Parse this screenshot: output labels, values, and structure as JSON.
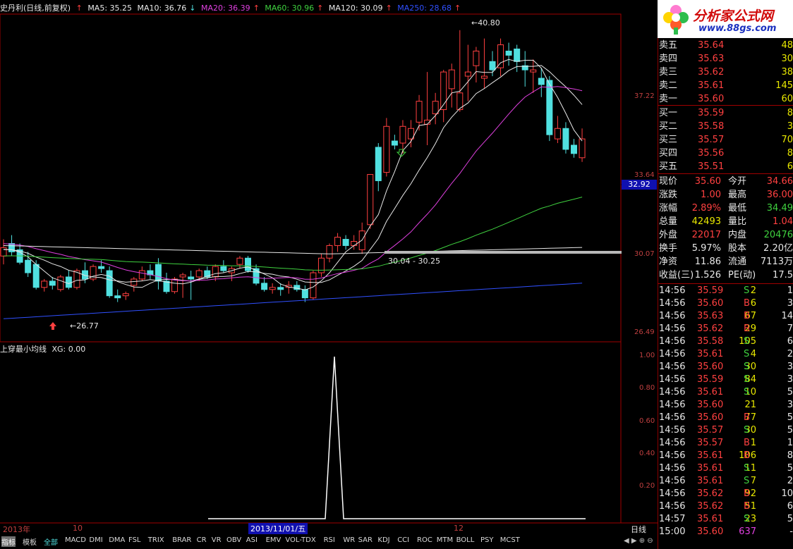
{
  "header": {
    "title": "史丹利(日线,前复权)",
    "ma": [
      {
        "label": "MA5: 35.25",
        "color": "#e8e8e8"
      },
      {
        "label": "MA10: 36.76",
        "color": "#e8e8e8"
      },
      {
        "label": "MA20: 36.39",
        "color": "#e040e0"
      },
      {
        "label": "MA60: 30.96",
        "color": "#3fd23f"
      },
      {
        "label": "MA120: 30.09",
        "color": "#e8e8e8"
      },
      {
        "label": "MA250: 28.68",
        "color": "#3050ff"
      }
    ]
  },
  "price_axis": {
    "labels": [
      "37.22",
      "33.64",
      "30.07",
      "26.49"
    ],
    "current_price_tag": "32.92"
  },
  "annotations": {
    "high": "40.80",
    "low": "26.77",
    "range": "30.04 - 30.25"
  },
  "indicator": {
    "title": "上穿最小均线",
    "value_label": "XG: 0.00",
    "axis_labels": [
      "1.00",
      "0.80",
      "0.60",
      "0.40",
      "0.20"
    ]
  },
  "date_axis": {
    "labels": [
      "2013年",
      "10",
      "2013/11/01/五",
      "12"
    ],
    "period": "日线"
  },
  "bottom_tabs": [
    "指标",
    "模板",
    "全部",
    "MACD",
    "DMI",
    "DMA",
    "FSL",
    "TRIX",
    "BRAR",
    "CR",
    "VR",
    "OBV",
    "ASI",
    "EMV",
    "VOL-TDX",
    "RSI",
    "WR",
    "SAR",
    "KDJ",
    "CCI",
    "ROC",
    "MTM",
    "BOLL",
    "PSY",
    "MCST"
  ],
  "logo": {
    "title": "分析家公式网",
    "url": "www.88gs.com"
  },
  "order_book": {
    "asks": [
      {
        "label": "卖五",
        "price": "35.64",
        "vol": "48"
      },
      {
        "label": "卖四",
        "price": "35.63",
        "vol": "30"
      },
      {
        "label": "卖三",
        "price": "35.62",
        "vol": "38"
      },
      {
        "label": "卖二",
        "price": "35.61",
        "vol": "145"
      },
      {
        "label": "卖一",
        "price": "35.60",
        "vol": "60"
      }
    ],
    "bids": [
      {
        "label": "买一",
        "price": "35.59",
        "vol": "8"
      },
      {
        "label": "买二",
        "price": "35.58",
        "vol": "3"
      },
      {
        "label": "买三",
        "price": "35.57",
        "vol": "70"
      },
      {
        "label": "买四",
        "price": "35.56",
        "vol": "8"
      },
      {
        "label": "买五",
        "price": "35.51",
        "vol": "6"
      }
    ]
  },
  "quote": [
    {
      "l1": "现价",
      "v1": "35.60",
      "c1": "red",
      "l2": "今开",
      "v2": "34.66",
      "c2": "red"
    },
    {
      "l1": "涨跌",
      "v1": "1.00",
      "c1": "red",
      "l2": "最高",
      "v2": "36.00",
      "c2": "red"
    },
    {
      "l1": "涨幅",
      "v1": "2.89%",
      "c1": "red",
      "l2": "最低",
      "v2": "34.49",
      "c2": "green"
    },
    {
      "l1": "总量",
      "v1": "42493",
      "c1": "yellow",
      "l2": "量比",
      "v2": "1.04",
      "c2": "red"
    },
    {
      "l1": "外盘",
      "v1": "22017",
      "c1": "red",
      "l2": "内盘",
      "v2": "20476",
      "c2": "green"
    },
    {
      "l1": "换手",
      "v1": "5.97%",
      "c1": "white",
      "l2": "股本",
      "v2": "2.20亿",
      "c2": "white"
    },
    {
      "l1": "净资",
      "v1": "11.86",
      "c1": "white",
      "l2": "流通",
      "v2": "7113万",
      "c2": "white"
    },
    {
      "l1": "收益(三)",
      "v1": "1.526",
      "c1": "white",
      "l2": "PE(动)",
      "v2": "17.5",
      "c2": "white"
    }
  ],
  "ticks": [
    {
      "time": "14:56",
      "price": "35.59",
      "vol": "2",
      "side": "S",
      "n": "1"
    },
    {
      "time": "14:56",
      "price": "35.60",
      "vol": "6",
      "side": "B",
      "n": "3"
    },
    {
      "time": "14:56",
      "price": "35.63",
      "vol": "67",
      "side": "B",
      "n": "14"
    },
    {
      "time": "14:56",
      "price": "35.62",
      "vol": "29",
      "side": "B",
      "n": "7"
    },
    {
      "time": "14:56",
      "price": "35.58",
      "vol": "105",
      "side": "S",
      "n": "6"
    },
    {
      "time": "14:56",
      "price": "35.61",
      "vol": "4",
      "side": "S",
      "n": "2"
    },
    {
      "time": "14:56",
      "price": "35.60",
      "vol": "30",
      "side": "S",
      "n": "3"
    },
    {
      "time": "14:56",
      "price": "35.59",
      "vol": "84",
      "side": "S",
      "n": "3"
    },
    {
      "time": "14:56",
      "price": "35.61",
      "vol": "10",
      "side": "S",
      "n": "5"
    },
    {
      "time": "14:56",
      "price": "35.60",
      "vol": "21",
      "side": "",
      "n": "3"
    },
    {
      "time": "14:56",
      "price": "35.60",
      "vol": "77",
      "side": "B",
      "n": "5"
    },
    {
      "time": "14:56",
      "price": "35.57",
      "vol": "30",
      "side": "S",
      "n": "5"
    },
    {
      "time": "14:56",
      "price": "35.57",
      "vol": "1",
      "side": "B",
      "n": "1"
    },
    {
      "time": "14:56",
      "price": "35.61",
      "vol": "106",
      "side": "B",
      "n": "8"
    },
    {
      "time": "14:56",
      "price": "35.61",
      "vol": "11",
      "side": "S",
      "n": "5"
    },
    {
      "time": "14:56",
      "price": "35.61",
      "vol": "7",
      "side": "S",
      "n": "2"
    },
    {
      "time": "14:56",
      "price": "35.62",
      "vol": "92",
      "B": "",
      "side": "B",
      "n": "10"
    },
    {
      "time": "14:56",
      "price": "35.62",
      "vol": "51",
      "side": "B",
      "n": "6"
    },
    {
      "time": "14:57",
      "price": "35.61",
      "vol": "23",
      "side": "S",
      "n": "5"
    },
    {
      "time": "15:00",
      "price": "35.60",
      "vol": "637",
      "side": "",
      "n": "-"
    }
  ],
  "chart_data": {
    "type": "candlestick",
    "ylim": [
      26.0,
      41.5
    ],
    "candles": [
      [
        30.0,
        30.8,
        29.6,
        30.4
      ],
      [
        30.6,
        31.0,
        30.0,
        30.2
      ],
      [
        30.3,
        30.6,
        29.6,
        29.7
      ],
      [
        29.8,
        30.2,
        29.0,
        29.2
      ],
      [
        29.6,
        29.8,
        28.4,
        28.5
      ],
      [
        28.5,
        28.9,
        28.3,
        28.8
      ],
      [
        28.8,
        29.0,
        28.4,
        28.6
      ],
      [
        28.4,
        29.1,
        28.3,
        29.0
      ],
      [
        29.0,
        29.3,
        28.4,
        28.5
      ],
      [
        28.5,
        29.4,
        28.4,
        29.3
      ],
      [
        29.3,
        29.7,
        28.7,
        28.9
      ],
      [
        28.9,
        29.6,
        28.8,
        29.5
      ],
      [
        29.5,
        29.8,
        29.2,
        29.4
      ],
      [
        29.3,
        29.5,
        28.0,
        28.1
      ],
      [
        28.1,
        28.4,
        27.8,
        28.0
      ],
      [
        28.1,
        28.3,
        27.9,
        28.2
      ],
      [
        28.6,
        29.0,
        28.3,
        28.9
      ],
      [
        28.9,
        29.5,
        28.8,
        29.3
      ],
      [
        29.3,
        29.6,
        28.9,
        29.1
      ],
      [
        29.6,
        29.9,
        28.4,
        28.8
      ],
      [
        28.8,
        29.2,
        28.2,
        28.3
      ],
      [
        28.3,
        29.0,
        28.2,
        28.9
      ],
      [
        29.0,
        29.2,
        28.0,
        29.1
      ],
      [
        29.0,
        29.3,
        27.9,
        28.9
      ],
      [
        29.0,
        29.4,
        28.8,
        29.3
      ],
      [
        29.3,
        29.5,
        28.9,
        29.0
      ],
      [
        29.0,
        29.6,
        28.8,
        29.5
      ],
      [
        29.5,
        29.8,
        29.2,
        29.3
      ],
      [
        29.2,
        29.5,
        28.8,
        29.4
      ],
      [
        29.6,
        30.0,
        29.4,
        29.9
      ],
      [
        29.9,
        30.0,
        29.2,
        29.3
      ],
      [
        29.4,
        29.6,
        28.6,
        28.7
      ],
      [
        28.7,
        29.0,
        28.3,
        28.4
      ],
      [
        28.4,
        28.7,
        28.2,
        28.5
      ],
      [
        28.5,
        28.7,
        28.1,
        28.4
      ],
      [
        28.5,
        28.8,
        28.2,
        28.6
      ],
      [
        28.6,
        28.8,
        28.3,
        28.4
      ],
      [
        28.4,
        28.6,
        27.8,
        28.0
      ],
      [
        28.0,
        29.3,
        27.9,
        29.2
      ],
      [
        29.2,
        30.1,
        29.0,
        29.9
      ],
      [
        29.9,
        30.6,
        29.7,
        30.5
      ],
      [
        30.5,
        31.1,
        30.2,
        30.9
      ],
      [
        30.8,
        31.0,
        30.3,
        30.5
      ],
      [
        30.5,
        31.0,
        30.3,
        30.7
      ],
      [
        30.3,
        31.6,
        30.1,
        31.2
      ],
      [
        31.5,
        33.9,
        31.3,
        33.9
      ],
      [
        35.2,
        35.4,
        33.1,
        33.6
      ],
      [
        34.0,
        36.6,
        33.8,
        36.2
      ],
      [
        35.5,
        35.8,
        35.1,
        35.3
      ],
      [
        35.4,
        36.5,
        34.9,
        36.2
      ],
      [
        35.6,
        36.5,
        35.2,
        36.1
      ],
      [
        36.4,
        37.7,
        36.0,
        37.4
      ],
      [
        36.3,
        38.8,
        35.3,
        36.5
      ],
      [
        36.8,
        37.8,
        36.3,
        37.4
      ],
      [
        37.0,
        38.9,
        36.4,
        38.8
      ],
      [
        38.0,
        39.2,
        37.1,
        38.9
      ],
      [
        37.0,
        40.8,
        36.9,
        37.8
      ],
      [
        38.6,
        40.1,
        37.4,
        38.8
      ],
      [
        39.1,
        40.0,
        38.3,
        39.8
      ],
      [
        38.5,
        40.4,
        38.0,
        38.6
      ],
      [
        39.3,
        39.8,
        38.6,
        38.9
      ],
      [
        39.0,
        40.4,
        38.6,
        40.1
      ],
      [
        39.8,
        40.2,
        39.1,
        39.6
      ],
      [
        39.9,
        40.1,
        38.8,
        39.3
      ],
      [
        39.1,
        39.8,
        38.1,
        38.9
      ],
      [
        38.8,
        39.4,
        37.8,
        38.9
      ],
      [
        38.5,
        39.0,
        37.6,
        38.2
      ],
      [
        38.4,
        38.6,
        35.5,
        35.8
      ],
      [
        35.6,
        36.7,
        35.4,
        36.1
      ],
      [
        36.1,
        36.4,
        34.9,
        35.1
      ],
      [
        35.3,
        35.6,
        34.7,
        34.9
      ],
      [
        34.7,
        36.1,
        34.5,
        35.6
      ]
    ]
  }
}
